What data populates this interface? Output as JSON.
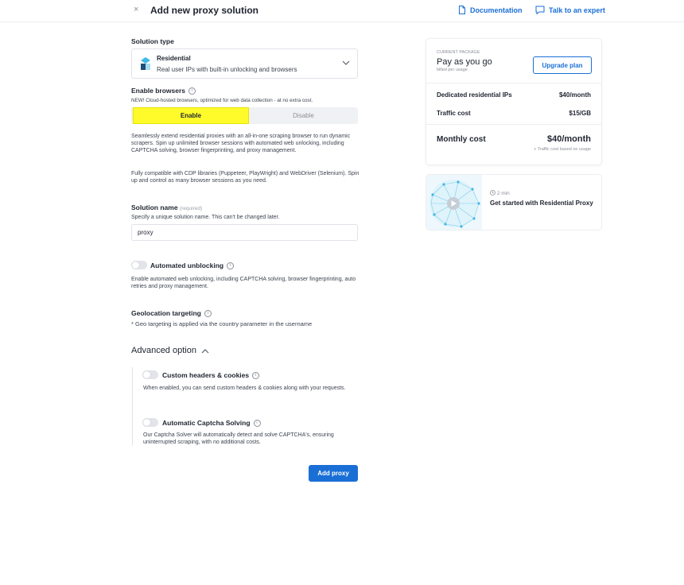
{
  "header": {
    "title": "Add new proxy solution",
    "close_glyph": "×",
    "documentation_label": "Documentation",
    "expert_label": "Talk to an expert"
  },
  "solution_type": {
    "label": "Solution type",
    "selected_title": "Residential",
    "selected_description": "Real user IPs with built-in unlocking and browsers"
  },
  "browsers": {
    "label": "Enable browsers",
    "note": "NEW! Cloud-hosted browsers, optimized for web data collection - at no extra cost.",
    "enable_label": "Enable",
    "disable_label": "Disable",
    "selected": "Enable",
    "description_1": "Seamlessly extend residential proxies with an all-in-one scraping browser to run dynamic scrapers. Spin up unlimited browser sessions with automated web unlocking, including CAPTCHA solving, browser fingerprinting, and proxy management.",
    "description_2": "Fully compatible with CDP libraries (Puppeteer, PlayWright) and WebDriver (Selenium). Spin up and control as many browser sessions as you need."
  },
  "solution_name": {
    "label": "Solution name",
    "required": "(required)",
    "hint": "Specify a unique solution name. This can't be changed later.",
    "value": "proxy"
  },
  "automated_unblocking": {
    "label": "Automated unblocking",
    "enabled": false,
    "description": "Enable automated web unlocking, including CAPTCHA solving, browser fingerprinting, auto retries and proxy management."
  },
  "geolocation": {
    "label": "Geolocation targeting",
    "note": "* Geo targeting is applied via the country parameter in the username"
  },
  "advanced": {
    "label": "Advanced option",
    "custom_headers_label": "Custom headers & cookies",
    "custom_headers_enabled": false,
    "custom_headers_description": "When enabled, you can send custom headers & cookies along with your requests.",
    "captcha_label": "Automatic Captcha Solving",
    "captcha_enabled": false,
    "captcha_description": "Our Captcha Solver will automatically detect and solve CAPTCHA's, ensuring uninterrupted scraping, with no additional costs."
  },
  "add_proxy_label": "Add proxy",
  "package": {
    "current_label": "CURRENT PACKAGE",
    "name": "Pay as you go",
    "billing": "billed per usage",
    "upgrade_label": "Upgrade plan",
    "rows": [
      {
        "label": "Dedicated residential IPs",
        "value": "$40/month"
      },
      {
        "label": "Traffic cost",
        "value": "$15/GB"
      }
    ],
    "monthly_label": "Monthly cost",
    "monthly_value": "$40/month",
    "monthly_note": "+ Traffic cost based on usage"
  },
  "video": {
    "duration": "2 min",
    "title": "Get started with Residential Proxy"
  },
  "colors": {
    "accent": "#1a6fd6",
    "highlight": "#fffb2b"
  }
}
